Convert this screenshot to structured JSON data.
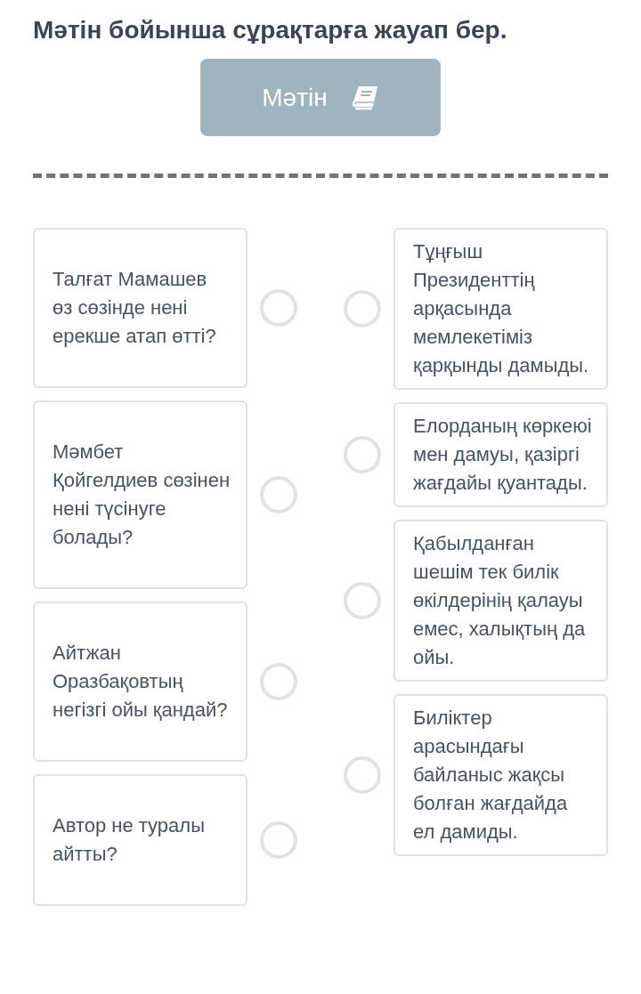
{
  "title": "Мәтін бойынша сұрақтарға жауап бер.",
  "text_button": {
    "label": "Мәтін"
  },
  "questions": [
    {
      "text": "Талғат Мамашев өз сөзінде нені ерекше атап өтті?",
      "selected": false
    },
    {
      "text": "Мәмбет Қойгелдиев сөзінен нені түсінуге болады?",
      "selected": false
    },
    {
      "text": "Айтжан Оразбақовтың негізгі ойы қандай?",
      "selected": false
    },
    {
      "text": "Автор не туралы айтты?",
      "selected": false
    }
  ],
  "answers": [
    {
      "text": "Тұңғыш Президенттің арқасында мемлекетіміз қарқынды дамыды.",
      "selected": false
    },
    {
      "text": "Елорданың көркеюі мен дамуы, қазіргі жағдайы қуантады.",
      "selected": false
    },
    {
      "text": "Қабылданған шешім тек билік өкілдерінің қалауы емес, халықтың да ойы.",
      "selected": false
    },
    {
      "text": "Биліктер арасындағы байланыс жақсы болған жағдайда ел дамиды.",
      "selected": false
    }
  ]
}
